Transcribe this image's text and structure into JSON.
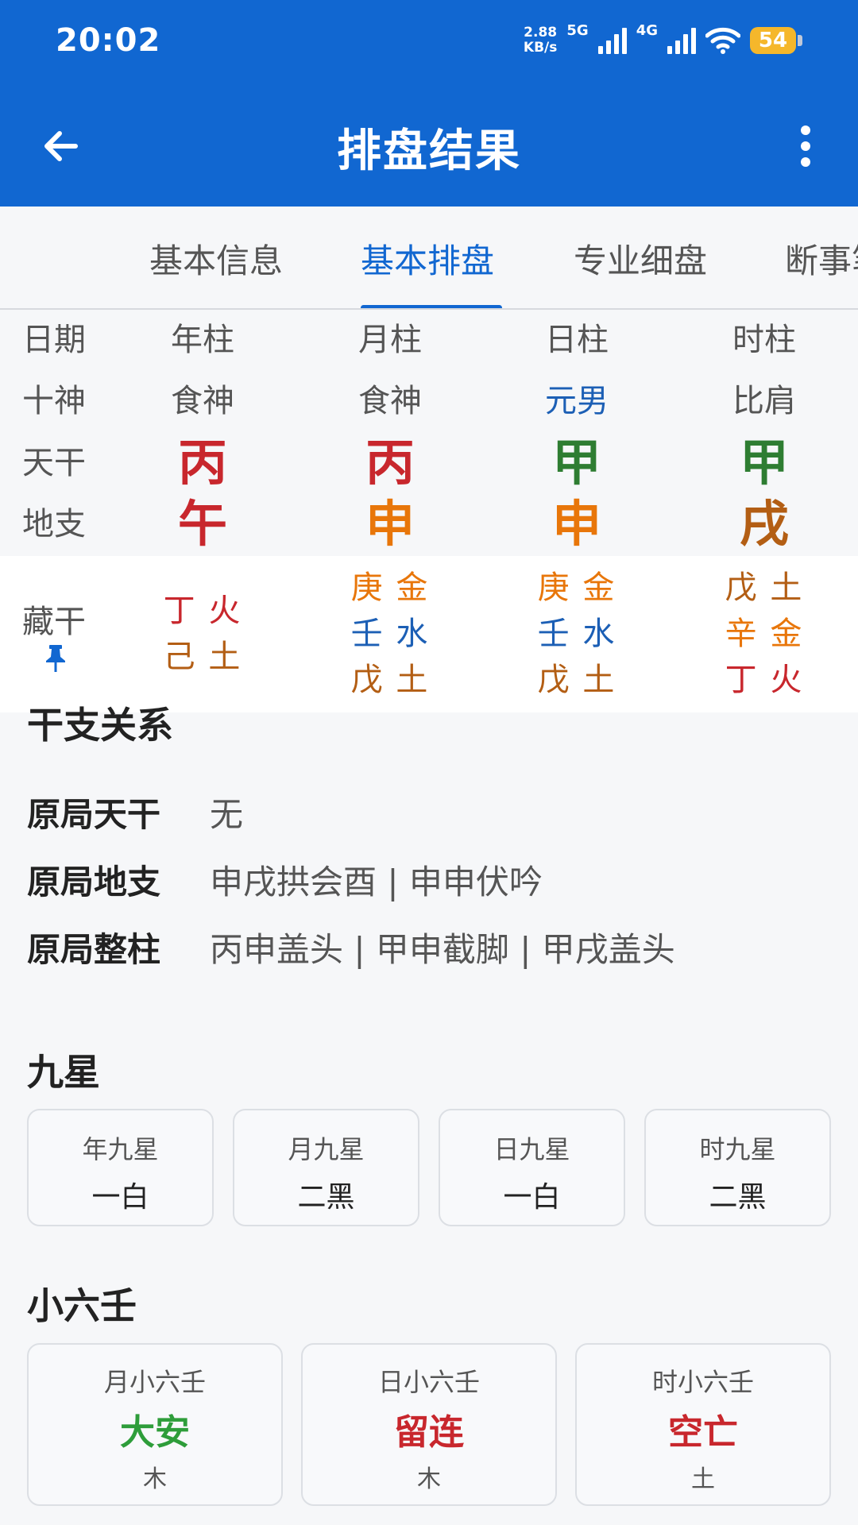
{
  "status_bar": {
    "time": "20:02",
    "net_speed_value": "2.88",
    "net_speed_unit": "KB/s",
    "signal1_label": "5G",
    "signal2_label": "4G",
    "battery": "54"
  },
  "header": {
    "title": "排盘结果"
  },
  "tabs": [
    {
      "label": "基本信息"
    },
    {
      "label": "基本排盘"
    },
    {
      "label": "专业细盘"
    },
    {
      "label": "断事笔记"
    }
  ],
  "pillars": {
    "row_labels": {
      "date": "日期",
      "shishen": "十神",
      "tiangan": "天干",
      "dizhi": "地支",
      "canggan": "藏干"
    },
    "columns": [
      {
        "name": "年柱",
        "shishen": "食神",
        "gan": "丙",
        "zhi": "午",
        "hidden": [
          {
            "text": "丁 火"
          },
          {
            "text": "己 土"
          }
        ]
      },
      {
        "name": "月柱",
        "shishen": "食神",
        "gan": "丙",
        "zhi": "申",
        "hidden": [
          {
            "text": "庚 金"
          },
          {
            "text": "壬 水"
          },
          {
            "text": "戊 土"
          }
        ]
      },
      {
        "name": "日柱",
        "shishen": "元男",
        "gan": "甲",
        "zhi": "申",
        "hidden": [
          {
            "text": "庚 金"
          },
          {
            "text": "壬 水"
          },
          {
            "text": "戊 土"
          }
        ]
      },
      {
        "name": "时柱",
        "shishen": "比肩",
        "gan": "甲",
        "zhi": "戌",
        "hidden": [
          {
            "text": "戊 土"
          },
          {
            "text": "辛 金"
          },
          {
            "text": "丁 火"
          }
        ]
      }
    ]
  },
  "relations": {
    "title": "干支关系",
    "rows": [
      {
        "label": "原局天干",
        "value": "无"
      },
      {
        "label": "原局地支",
        "value": "申戌拱会酉 | 申申伏吟"
      },
      {
        "label": "原局整柱",
        "value": "丙申盖头 | 甲申截脚 | 甲戌盖头"
      }
    ]
  },
  "nine_stars": {
    "title": "九星",
    "cards": [
      {
        "label": "年九星",
        "value": "一白"
      },
      {
        "label": "月九星",
        "value": "二黑"
      },
      {
        "label": "日九星",
        "value": "一白"
      },
      {
        "label": "时九星",
        "value": "二黑"
      }
    ]
  },
  "little_liuren": {
    "title": "小六壬",
    "cards": [
      {
        "label": "月小六壬",
        "value": "大安",
        "element": "木"
      },
      {
        "label": "日小六壬",
        "value": "留连",
        "element": "木"
      },
      {
        "label": "时小六壬",
        "value": "空亡",
        "element": "土"
      }
    ]
  },
  "colors": {
    "primary": "#1167d1",
    "fire_red": "#c8272d",
    "metal_orange": "#e8760a",
    "wood_green": "#2e7d32",
    "earth_brown": "#b35e14",
    "water_blue": "#1c5fb5"
  }
}
